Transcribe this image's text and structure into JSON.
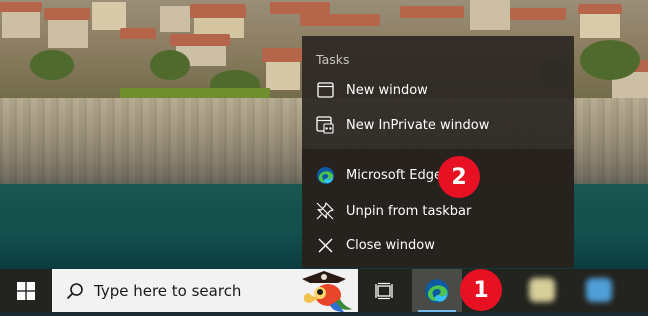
{
  "jump_list": {
    "heading": "Tasks",
    "tasks": [
      {
        "label": "New window",
        "icon": "window-icon"
      },
      {
        "label": "New InPrivate window",
        "icon": "inprivate-window-icon"
      }
    ],
    "app": {
      "label": "Microsoft Edge",
      "icon": "edge-icon"
    },
    "actions": [
      {
        "label": "Unpin from taskbar",
        "icon": "unpin-icon"
      },
      {
        "label": "Close window",
        "icon": "close-icon"
      }
    ]
  },
  "markers": {
    "first": "1",
    "second": "2"
  },
  "taskbar": {
    "search_placeholder": "Type here to search",
    "start_icon": "windows-logo-icon",
    "task_view_icon": "task-view-icon",
    "pinned_app_icon": "edge-icon"
  },
  "colors": {
    "marker": "#e81123",
    "menu_bg": "#2c2824",
    "taskbar_bg": "#23231f",
    "edge_blue": "#0c59a4",
    "edge_green": "#4fc44d"
  }
}
